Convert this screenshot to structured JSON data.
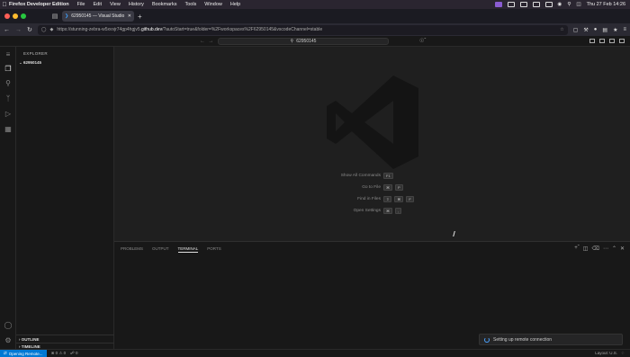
{
  "menubar": {
    "app": "Firefox Developer Edition",
    "items": [
      "File",
      "Edit",
      "View",
      "History",
      "Bookmarks",
      "Tools",
      "Window",
      "Help"
    ],
    "clock": "Thu 27 Feb 14:26"
  },
  "browser": {
    "tab_title": "62950145 — Visual Studio Code — GitHub",
    "url_prefix": "https://stunning-zebra-w5xvvjr74gp4hgjv5.",
    "url_host": "github.dev",
    "url_suffix": "/?autoStart=true&folder=%2Fworkspaces%2F62950145&vscodeChannel=stable"
  },
  "vscode": {
    "command_center": "62950145",
    "sidebar": {
      "title": "EXPLORER",
      "folder": "62950145",
      "outline": "OUTLINE",
      "timeline": "TIMELINE"
    },
    "hints": [
      {
        "label": "Show All Commands",
        "keys": [
          "F1"
        ]
      },
      {
        "label": "Go to File",
        "keys": [
          "⌘",
          "P"
        ]
      },
      {
        "label": "Find in Files",
        "keys": [
          "⇧",
          "⌘",
          "F"
        ]
      },
      {
        "label": "Open Settings",
        "keys": [
          "⌘",
          ","
        ]
      }
    ],
    "panel_tabs": [
      "PROBLEMS",
      "OUTPUT",
      "TERMINAL",
      "PORTS"
    ],
    "active_panel_tab": "TERMINAL",
    "toast": "Setting up remote connection",
    "status": {
      "remote": "Opening Remote...",
      "errors": "0",
      "warnings": "0",
      "ports": "0",
      "layout": "Layout: U.S."
    }
  },
  "colors": {
    "accent": "#0078d4",
    "close": "#ff5f57",
    "minimize": "#febc2e",
    "maximize": "#28c840"
  }
}
